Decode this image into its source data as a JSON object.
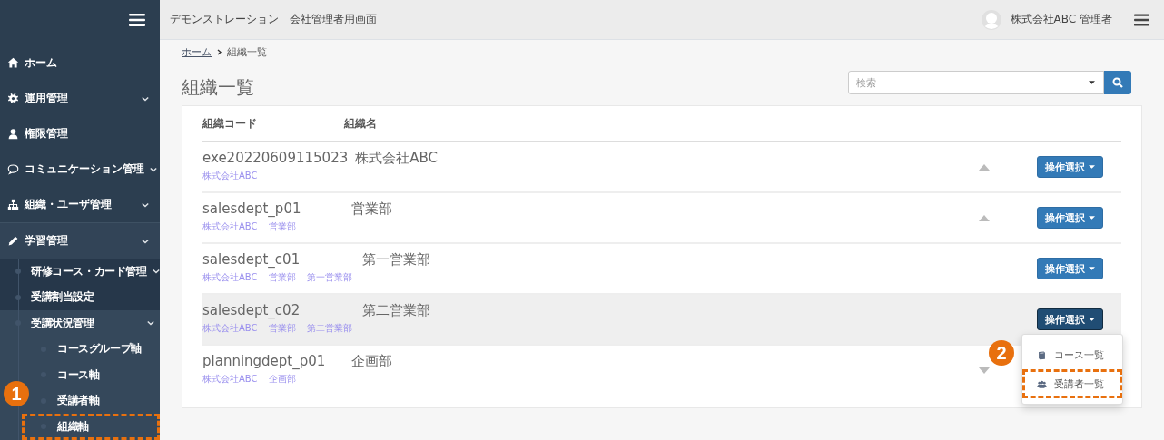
{
  "sidebar": {
    "items": [
      {
        "label": "ホーム",
        "kind": "home",
        "expandable": false
      },
      {
        "label": "運用管理",
        "kind": "gear",
        "expandable": true,
        "expanded": false
      },
      {
        "label": "権限管理",
        "kind": "user",
        "expandable": false
      },
      {
        "label": "コミュニケーション管理",
        "kind": "comment",
        "expandable": true,
        "expanded": false
      },
      {
        "label": "組織・ユーザ管理",
        "kind": "sitemap",
        "expandable": true,
        "expanded": false
      },
      {
        "label": "学習管理",
        "kind": "pencil",
        "expandable": true,
        "expanded": true,
        "children": [
          {
            "label": "研修コース・カード管理",
            "expandable": true,
            "expanded": false
          },
          {
            "label": "受講割当設定",
            "expandable": false
          },
          {
            "label": "受講状況管理",
            "expandable": true,
            "expanded": true,
            "children": [
              {
                "label": "コースグループ軸",
                "expandable": false,
                "highlighted": false
              },
              {
                "label": "コース軸",
                "expandable": false,
                "highlighted": false
              },
              {
                "label": "受講者軸",
                "expandable": false,
                "highlighted": false
              },
              {
                "label": "組織軸",
                "expandable": false,
                "highlighted": true,
                "callout": "1"
              }
            ]
          }
        ]
      }
    ]
  },
  "header": {
    "site": "デモンストレーション",
    "screen": "会社管理者用画面",
    "user": "株式会社ABC 管理者"
  },
  "breadcrumb": {
    "home": "ホーム",
    "current": "組織一覧"
  },
  "title": "組織一覧",
  "search": {
    "placeholder": "検索"
  },
  "table": {
    "columns": [
      "組織コード",
      "組織名"
    ],
    "rows": [
      {
        "code": "exe20220609115023",
        "name": "株式会社ABC",
        "path": [
          "株式会社ABC"
        ],
        "expandable": true,
        "expanded": true,
        "selected": false,
        "action": {
          "label": "操作選択",
          "open": false
        },
        "children": [
          {
            "code": "salesdept_p01",
            "name": "営業部",
            "path": [
              "株式会社ABC",
              "営業部"
            ],
            "expandable": true,
            "expanded": true,
            "selected": false,
            "action": {
              "label": "操作選択",
              "open": false
            },
            "children": [
              {
                "code": "salesdept_c01",
                "name": "第一営業部",
                "path": [
                  "株式会社ABC",
                  "営業部",
                  "第一営業部"
                ],
                "expandable": false,
                "selected": false,
                "action": {
                  "label": "操作選択",
                  "open": false
                }
              },
              {
                "code": "salesdept_c02",
                "name": "第二営業部",
                "path": [
                  "株式会社ABC",
                  "営業部",
                  "第二営業部"
                ],
                "expandable": false,
                "selected": true,
                "action": {
                  "label": "操作選択",
                  "open": true,
                  "menu": [
                    {
                      "label": "コース一覧",
                      "kind": "book",
                      "highlighted": false
                    },
                    {
                      "label": "受講者一覧",
                      "kind": "users",
                      "highlighted": true,
                      "callout": "2"
                    }
                  ]
                }
              }
            ]
          },
          {
            "code": "planningdept_p01",
            "name": "企画部",
            "path": [
              "株式会社ABC",
              "企画部"
            ],
            "expandable": true,
            "expanded": false,
            "selected": false
          }
        ]
      }
    ]
  }
}
